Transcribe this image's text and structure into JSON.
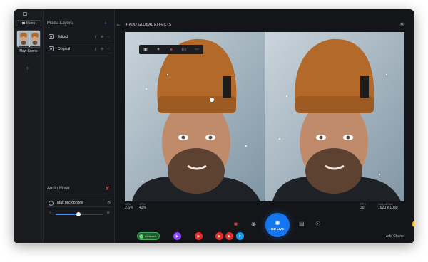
{
  "sidebar": {
    "menu_label": "Menu",
    "scene_label": "New Scene",
    "add_symbol": "+"
  },
  "layers_panel": {
    "title": "Media Layers",
    "add_symbol": "+",
    "items": [
      {
        "label": "Edited"
      },
      {
        "label": "Original"
      }
    ]
  },
  "audio": {
    "title": "Audio Mixer",
    "device_label": "Mac Microphone",
    "volume": 0.48
  },
  "topbar": {
    "global_effects_label": "ADD GLOBAL EFFECTS"
  },
  "stats": [
    {
      "label": "CPU",
      "value": "2.6%"
    },
    {
      "label": "GPU",
      "value": "42%"
    },
    {
      "label": "FPS",
      "value": "30"
    },
    {
      "label": "Output Size",
      "value": "1920 x 1080"
    }
  ],
  "controls": {
    "go_live_label": "GO LIVE"
  },
  "channels": {
    "webcam_label": "Webcam",
    "add_channel_label": "Add Chanel",
    "items": [
      {
        "icon": "twitch-icon",
        "color": "#8b44f7"
      },
      {
        "icon": "youtube-icon",
        "color": "#e52d27"
      },
      {
        "icon": "youtube-icon",
        "color": "#e52d27"
      },
      {
        "icon": "youtube-icon",
        "color": "#e52d27"
      },
      {
        "icon": "share-icon",
        "color": "#1d9bf0"
      }
    ]
  },
  "colors": {
    "accent": "#1577f0",
    "danger": "#e0433f",
    "active": "#3fae5c"
  }
}
